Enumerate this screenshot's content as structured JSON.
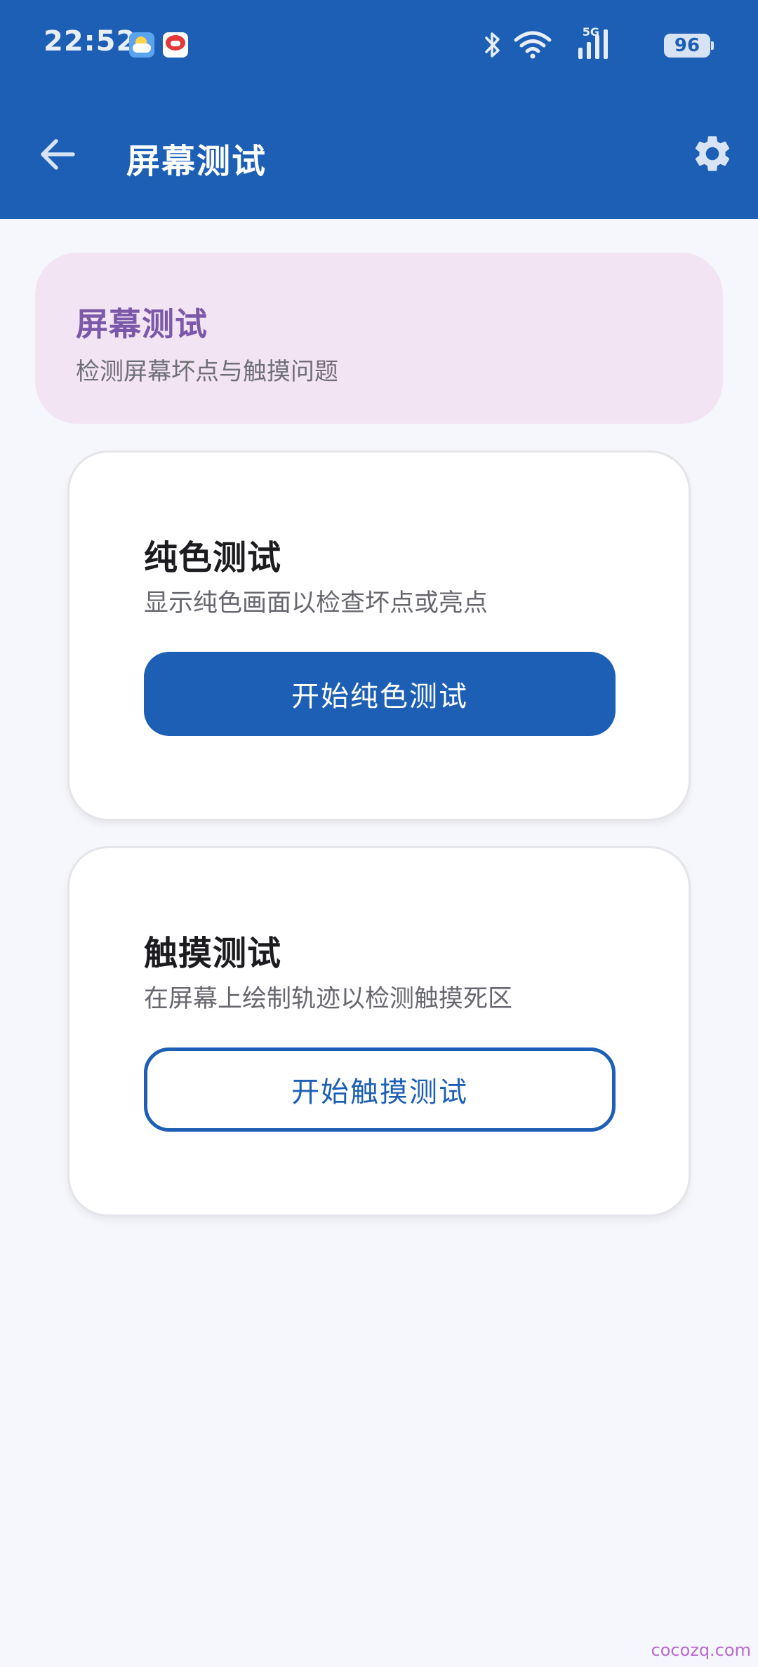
{
  "status_bar": {
    "time": "22:52",
    "network_label": "5G",
    "battery": "96",
    "icons": [
      "weather-icon",
      "game-app-icon",
      "bluetooth-icon",
      "wifi-icon",
      "cellular-signal-icon",
      "battery-icon"
    ]
  },
  "app_bar": {
    "title": "屏幕测试",
    "back_icon": "arrow-back-icon",
    "settings_icon": "gear-icon"
  },
  "header": {
    "title": "屏幕测试",
    "subtitle": "检测屏幕坏点与触摸问题"
  },
  "cards": [
    {
      "title": "纯色测试",
      "description": "显示纯色画面以检查坏点或亮点",
      "button_label": "开始纯色测试"
    },
    {
      "title": "触摸测试",
      "description": "在屏幕上绘制轨迹以检测触摸死区",
      "button_label": "开始触摸测试"
    }
  ],
  "watermark": "cocozq.com",
  "colors": {
    "primary": "#1c5fb4",
    "header_card_bg": "#f3e4f4",
    "header_title": "#7b59a8",
    "page_bg": "#f6f7fc"
  }
}
